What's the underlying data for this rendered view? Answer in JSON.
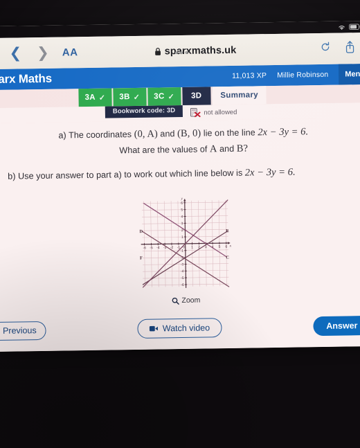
{
  "status_bar": {
    "wifi_icon": "wifi-icon",
    "battery_icon": "battery-icon"
  },
  "browser": {
    "back_icon": "chevron-left-icon",
    "forward_icon": "chevron-right-icon",
    "text_size_label": "AA",
    "lock_icon": "lock-icon",
    "url": "sparxmaths.uk",
    "reload_icon": "reload-icon",
    "share_icon": "share-icon",
    "tab_overview_dots": "•••"
  },
  "header": {
    "brand": "parx Maths",
    "xp": "11,013 XP",
    "user": "Millie Robinson",
    "menu_label": "Menu",
    "brand_color": "#1368c4"
  },
  "tabs": [
    {
      "label": "3A",
      "state": "complete",
      "tick": "✓"
    },
    {
      "label": "3B",
      "state": "complete",
      "tick": "✓"
    },
    {
      "label": "3C",
      "state": "complete",
      "tick": "✓"
    },
    {
      "label": "3D",
      "state": "active",
      "tick": ""
    },
    {
      "label": "Summary",
      "state": "summary",
      "tick": ""
    }
  ],
  "bookwork": {
    "code_label": "Bookwork code: 3D",
    "calculator_icon": "calculator-not-allowed-icon",
    "not_allowed_label": "not allowed"
  },
  "question": {
    "part_a_lead": "a)",
    "part_a_text_1": "The coordinates",
    "part_a_coord_1": "(0, A)",
    "part_a_and": "and",
    "part_a_coord_2": "(B, 0)",
    "part_a_text_2": "lie on the line",
    "part_a_equation": "2x − 3y = 6.",
    "part_a_line2_pre": "What are the values of",
    "part_a_line2_A": "A",
    "part_a_line2_and": "and",
    "part_a_line2_B": "B?",
    "part_b_lead": "b)",
    "part_b_text": "Use your answer to part a) to work out which line below is",
    "part_b_equation": "2x − 3y = 6."
  },
  "chart_data": {
    "type": "line",
    "title": "",
    "xlabel": "x",
    "ylabel": "y",
    "xlim": [
      -6.6,
      6.6
    ],
    "ylim": [
      -6.6,
      6.6
    ],
    "xticks": [
      -6,
      -5,
      -4,
      -3,
      -2,
      -1,
      0,
      1,
      2,
      3,
      4,
      5,
      6
    ],
    "yticks": [
      -6,
      -5,
      -4,
      -3,
      -2,
      -1,
      1,
      2,
      3,
      4,
      5,
      6
    ],
    "grid": true,
    "grid_color": "#dab6bd",
    "axis_color": "#4a2b38",
    "series": [
      {
        "name": "C",
        "label": "C",
        "label_at": [
          6.4,
          -2.3
        ],
        "color": "#8d4f74",
        "points": [
          [
            -6,
            6
          ],
          [
            6,
            -2
          ]
        ],
        "note": "descending line through (0,2) and (3,0)"
      },
      {
        "name": "D",
        "label": "D",
        "label_at": [
          -6.7,
          1.7
        ],
        "color": "#7a4a5e",
        "points": [
          [
            -6.3,
            1.9
          ],
          [
            6.3,
            -6.4
          ]
        ],
        "note": "descending shallow line through (-3,0) and (0,-2)"
      },
      {
        "name": "E",
        "label": "E",
        "label_at": [
          6.4,
          1.6
        ],
        "color": "#6d4355",
        "points": [
          [
            -6.3,
            -5.9
          ],
          [
            6.3,
            1.8
          ]
        ],
        "note": "ascending shallow line through (-3,0) and (0,2)"
      },
      {
        "name": "F",
        "label": "F",
        "label_at": [
          -6.7,
          -2.2
        ],
        "color": "#7c4761",
        "points": [
          [
            -6.3,
            -6.3
          ],
          [
            6.3,
            6.3
          ]
        ],
        "note": "ascending steep line through (0,0) region, passing (0,2)→(3,6)"
      }
    ]
  },
  "footer": {
    "zoom_label": "Zoom",
    "zoom_icon": "magnifier-icon",
    "previous_label": "Previous",
    "previous_icon": "chevron-left-icon",
    "watch_video_label": "Watch video",
    "video_icon": "video-camera-icon",
    "answer_label": "Answer",
    "answer_color": "#0d6bbd"
  }
}
